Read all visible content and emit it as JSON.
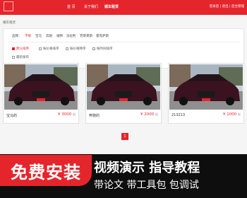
{
  "header": {
    "nav": [
      "首 页",
      "关于我们",
      "婚车租赁"
    ],
    "user_links": "登录后 | 退出 | 后台管理"
  },
  "breadcrumb": "婚车租赁",
  "filters": {
    "brand_label": "品牌：",
    "brands": [
      "不限",
      "宝马",
      "奔驰",
      "福特",
      "法拉利",
      "劳斯莱斯",
      "雷克萨斯"
    ],
    "sort_options": [
      "默认排序",
      "按价格排序",
      "按价格降序",
      "按时间排序",
      "最新发布"
    ]
  },
  "cards": [
    {
      "name": "宝马的",
      "price": "¥ 3000",
      "unit": "起"
    },
    {
      "name": "奔驰的",
      "price": "¥ 2000",
      "unit": "起"
    },
    {
      "name": "213213",
      "price": "¥ 1000",
      "unit": "起"
    }
  ],
  "pagination": {
    "current": "1"
  },
  "promo": {
    "free_install": "免费安装",
    "title": "视频演示 指导教程",
    "subtitle": "带论文 带工具包 包调试"
  },
  "colors": {
    "accent": "#e5252c",
    "promo_bg": "#0e0e0e"
  }
}
